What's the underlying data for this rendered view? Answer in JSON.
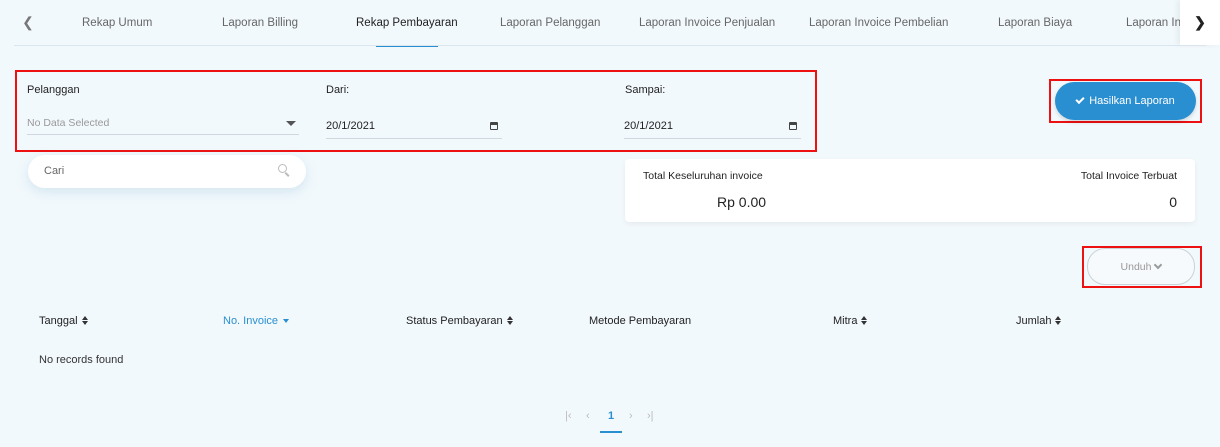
{
  "tabs": {
    "items": [
      {
        "label": "Rekap Umum",
        "active": false
      },
      {
        "label": "Laporan Billing",
        "active": false
      },
      {
        "label": "Rekap Pembayaran",
        "active": true
      },
      {
        "label": "Laporan Pelanggan",
        "active": false
      },
      {
        "label": "Laporan Invoice Penjualan",
        "active": false
      },
      {
        "label": "Laporan Invoice Pembelian",
        "active": false
      },
      {
        "label": "Laporan Biaya",
        "active": false
      },
      {
        "label": "Laporan Inventori",
        "active": false
      }
    ],
    "prev_icon": "chevron-left-icon",
    "next_icon": "chevron-right-icon"
  },
  "filters": {
    "customer": {
      "label": "Pelanggan",
      "value": "No Data Selected"
    },
    "from": {
      "label": "Dari:",
      "value": "20/1/2021"
    },
    "to": {
      "label": "Sampai:",
      "value": "20/1/2021"
    }
  },
  "generate_button": {
    "label": "Hasilkan Laporan",
    "icon": "check-icon"
  },
  "search": {
    "placeholder": "Cari",
    "icon": "search-icon"
  },
  "summary": {
    "total_label": "Total Keseluruhan invoice",
    "total_value": "Rp 0.00",
    "count_label": "Total Invoice Terbuat",
    "count_value": "0"
  },
  "download_button": {
    "label": "Unduh",
    "icon": "chevron-down-icon"
  },
  "table": {
    "columns": [
      "Tanggal",
      "No. Invoice",
      "Status Pembayaran",
      "Metode Pembayaran",
      "Mitra",
      "Jumlah"
    ],
    "empty_message": "No records found"
  },
  "pagination": {
    "current_page": "1"
  },
  "colors": {
    "accent": "#2a8fd0",
    "highlight_border": "#e11111",
    "background": "#f2f9fd"
  }
}
